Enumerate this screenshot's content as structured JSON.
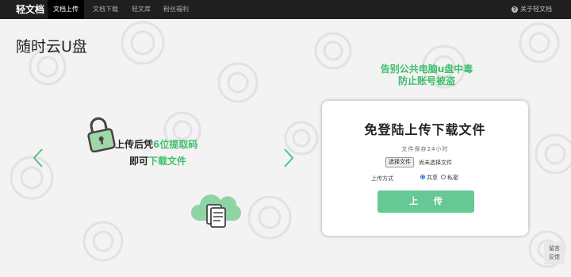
{
  "nav": {
    "brand": "轻文档",
    "tabs": [
      "文档上传",
      "文档下载",
      "轻文库",
      "粉丝福利"
    ],
    "active_tab": "文档上传",
    "about": "关于轻文档"
  },
  "page_title": "随时云U盘",
  "promo": {
    "line1": "告别公共电脑u盘中毒",
    "line2": "防止账号被盗"
  },
  "hero": {
    "line1_prefix": "上传后凭",
    "line1_highlight": "6位提取码",
    "line2_prefix": "即可",
    "line2_highlight": "下载文件"
  },
  "panel": {
    "title": "免登陆上传下载文件",
    "retention": "文件保存24小时",
    "file_button": "选择文件",
    "file_status": "尚未选择文件",
    "method_label": "上传方式",
    "options": [
      "共享",
      "私密"
    ],
    "selected_option": "共享",
    "upload_button": "上 传"
  },
  "feedback": {
    "line1": "留言",
    "line2": "反馈"
  },
  "icons": {
    "carousel_prev": "chevron-left-icon",
    "carousel_next": "chevron-right-icon",
    "lock": "lock-icon",
    "cloud": "cloud-document-icon",
    "about": "question-circle-icon"
  },
  "colors": {
    "accent": "#3fbf6f",
    "button": "#66c894",
    "nav_bg": "#1f1f1f"
  }
}
